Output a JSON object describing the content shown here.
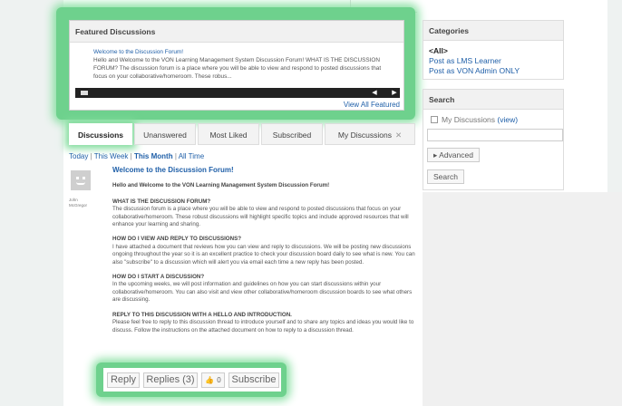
{
  "featured": {
    "heading": "Featured Discussions",
    "item_title": "Welcome to the Discussion Forum!",
    "item_snippet": "Hello and Welcome to the VON Learning Management System Discussion Forum! WHAT IS THE DISCUSSION FORUM? The discussion forum is a place where you will be able to view and respond to posted discussions that focus on your collaborative/homeroom.  These robus...",
    "prev_icon": "◀",
    "next_icon": "▶",
    "view_all": "View All Featured"
  },
  "tabs": [
    {
      "label": "Discussions",
      "active": true
    },
    {
      "label": "Unanswered"
    },
    {
      "label": "Most Liked"
    },
    {
      "label": "Subscribed"
    },
    {
      "label": "My Discussions",
      "close": "✕"
    }
  ],
  "filter": {
    "today": "Today",
    "this_week": "This Week",
    "this_month": "This Month",
    "all_time": "All Time",
    "sep": "|"
  },
  "post": {
    "author": "John McGregor",
    "title": "Welcome to the Discussion Forum!",
    "intro": "Hello and Welcome to the VON Learning Management System Discussion Forum!",
    "sections": [
      {
        "heading": "What is the discussion forum?",
        "body": "The discussion forum is a place where you will be able to view and respond to posted discussions that focus on your collaborative/homeroom.  These robust discussions will highlight specific topics and include approved resources that will enhance your learning and sharing."
      },
      {
        "heading": "How do I view and reply to discussions?",
        "body": "I have attached a document that reviews how you can view and reply to discussions.  We will be posting new discussions ongoing throughout the year so it is an excellent practice to check your discussion board daily to see what is new.  You can also \"subscribe\" to a discussion which will alert you via email each time a new reply has been posted."
      },
      {
        "heading": "How do I start a discussion?",
        "body": "In the upcoming weeks, we will post information and guidelines on how you can start discussions within your collaborative/homeroom.  You can also visit and view other collaborative/homeroom discussion boards to see what others are discussing."
      },
      {
        "heading": "Reply to this discussion with a hello and introduction.",
        "body": "Please feel free to reply to this discussion thread to introduce yourself and to share any topics and ideas you would like to discuss.  Follow the instructions on the attached document on how to reply to a discussion thread."
      }
    ]
  },
  "actions": {
    "reply": "Reply",
    "replies": "Replies (3)",
    "like_icon": "👍",
    "like_count": "0",
    "subscribe": "Subscribe"
  },
  "sidebar": {
    "categories_heading": "Categories",
    "categories": [
      "<All>",
      "Post as LMS Learner",
      "Post as VON Admin ONLY"
    ],
    "search_heading": "Search",
    "my_discussions_label": "My Discussions",
    "view_link": "(view)",
    "advanced_label": "▸ Advanced",
    "search_button": "Search"
  }
}
